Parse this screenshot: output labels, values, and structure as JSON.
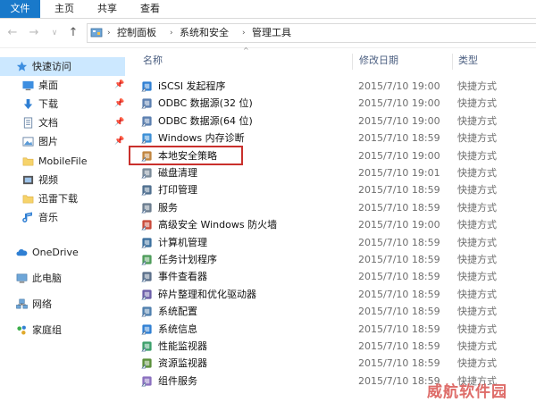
{
  "ribbon": {
    "tabs": [
      "文件",
      "主页",
      "共享",
      "查看"
    ]
  },
  "address": {
    "crumbs": [
      "控制面板",
      "系统和安全",
      "管理工具"
    ]
  },
  "sidebar": {
    "items": [
      {
        "label": "快速访问",
        "icon": "star-icon",
        "pinned": false
      },
      {
        "label": "桌面",
        "icon": "desktop-icon",
        "pinned": true
      },
      {
        "label": "下载",
        "icon": "download-icon",
        "pinned": true
      },
      {
        "label": "文档",
        "icon": "document-icon",
        "pinned": true
      },
      {
        "label": "图片",
        "icon": "picture-icon",
        "pinned": true
      },
      {
        "label": "MobileFile",
        "icon": "folder-icon",
        "pinned": false
      },
      {
        "label": "视频",
        "icon": "video-icon",
        "pinned": false
      },
      {
        "label": "迅雷下载",
        "icon": "folder-icon",
        "pinned": false
      },
      {
        "label": "音乐",
        "icon": "music-icon",
        "pinned": false
      },
      {
        "label": "OneDrive",
        "icon": "cloud-icon",
        "pinned": false
      },
      {
        "label": "此电脑",
        "icon": "computer-icon",
        "pinned": false
      },
      {
        "label": "网络",
        "icon": "network-icon",
        "pinned": false
      },
      {
        "label": "家庭组",
        "icon": "homegroup-icon",
        "pinned": false
      }
    ]
  },
  "columns": {
    "name": "名称",
    "date": "修改日期",
    "type": "类型"
  },
  "files": [
    {
      "name": "iSCSI 发起程序",
      "date": "2015/7/10 19:00",
      "type": "快捷方式"
    },
    {
      "name": "ODBC 数据源(32 位)",
      "date": "2015/7/10 19:00",
      "type": "快捷方式"
    },
    {
      "name": "ODBC 数据源(64 位)",
      "date": "2015/7/10 19:00",
      "type": "快捷方式"
    },
    {
      "name": "Windows 内存诊断",
      "date": "2015/7/10 18:59",
      "type": "快捷方式"
    },
    {
      "name": "本地安全策略",
      "date": "2015/7/10 19:00",
      "type": "快捷方式"
    },
    {
      "name": "磁盘清理",
      "date": "2015/7/10 19:01",
      "type": "快捷方式"
    },
    {
      "name": "打印管理",
      "date": "2015/7/10 18:59",
      "type": "快捷方式"
    },
    {
      "name": "服务",
      "date": "2015/7/10 18:59",
      "type": "快捷方式"
    },
    {
      "name": "高级安全 Windows 防火墙",
      "date": "2015/7/10 19:00",
      "type": "快捷方式"
    },
    {
      "name": "计算机管理",
      "date": "2015/7/10 18:59",
      "type": "快捷方式"
    },
    {
      "name": "任务计划程序",
      "date": "2015/7/10 18:59",
      "type": "快捷方式"
    },
    {
      "name": "事件查看器",
      "date": "2015/7/10 18:59",
      "type": "快捷方式"
    },
    {
      "name": "碎片整理和优化驱动器",
      "date": "2015/7/10 18:59",
      "type": "快捷方式"
    },
    {
      "name": "系统配置",
      "date": "2015/7/10 18:59",
      "type": "快捷方式"
    },
    {
      "name": "系统信息",
      "date": "2015/7/10 18:59",
      "type": "快捷方式"
    },
    {
      "name": "性能监视器",
      "date": "2015/7/10 18:59",
      "type": "快捷方式"
    },
    {
      "name": "资源监视器",
      "date": "2015/7/10 18:59",
      "type": "快捷方式"
    },
    {
      "name": "组件服务",
      "date": "2015/7/10 18:59",
      "type": "快捷方式"
    }
  ],
  "watermark": "威航软件园",
  "colors": {
    "accent": "#1979ca",
    "selected": "#cce8ff",
    "highlight": "#c9302c"
  }
}
